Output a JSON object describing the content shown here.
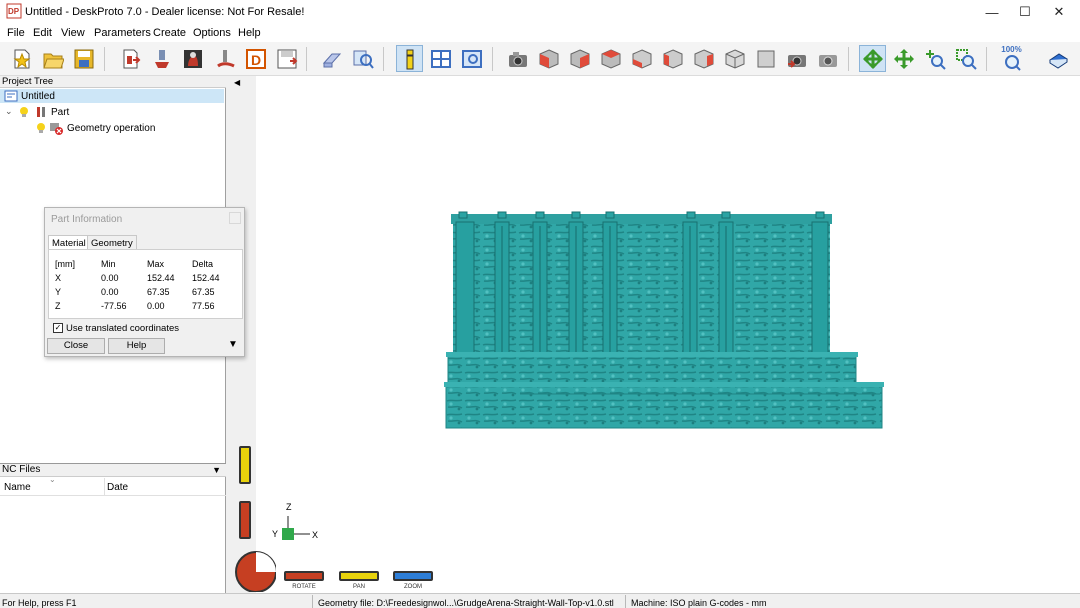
{
  "window": {
    "title": "Untitled - DeskProto 7.0 - Dealer license: Not For Resale!",
    "app_icon_text": "DP",
    "minimize_glyph": "—",
    "maximize_glyph": "☐",
    "close_glyph": "✕"
  },
  "menu": [
    "File",
    "Edit",
    "View",
    "Parameters",
    "Create",
    "Options",
    "Help"
  ],
  "toolbar": {
    "zoom_percent": "100%"
  },
  "project_tree": {
    "header": "Project Tree",
    "root": "Untitled",
    "part": "Part",
    "operation": "Geometry operation"
  },
  "part_info": {
    "title": "Part Information",
    "tabs": [
      "Material",
      "Geometry"
    ],
    "headers": [
      "[mm]",
      "Min",
      "Max",
      "Delta"
    ],
    "rows": [
      [
        "X",
        "0.00",
        "152.44",
        "152.44"
      ],
      [
        "Y",
        "0.00",
        "67.35",
        "67.35"
      ],
      [
        "Z",
        "-77.56",
        "0.00",
        "77.56"
      ]
    ],
    "checkbox_label": "Use translated coordinates",
    "checkbox_checked": true,
    "close_label": "Close",
    "help_label": "Help"
  },
  "nc_files": {
    "header": "NC Files",
    "columns": [
      "Name",
      "Date"
    ]
  },
  "axes": {
    "z": "Z",
    "y": "Y",
    "x": "X"
  },
  "controls": {
    "rotate": "ROTATE",
    "pan": "PAN",
    "zoom": "ZOOM"
  },
  "status": {
    "help": "For Help, press F1",
    "geometry_file": "Geometry file: D:\\Freedesignwol...\\GrudgeArena-Straight-Wall-Top-v1.0.stl",
    "machine": "Machine: ISO plain G-codes - mm"
  },
  "colors": {
    "model": "#2fa6a6",
    "accent": "#0078d7",
    "selection": "#cde6f7"
  }
}
